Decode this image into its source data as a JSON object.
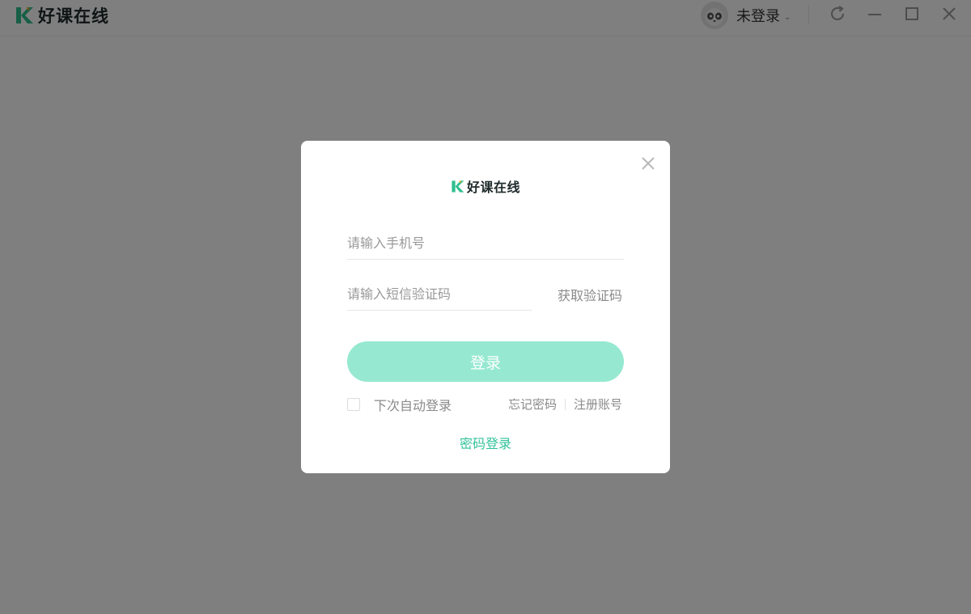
{
  "app": {
    "title": "好课在线",
    "accent_color": "#33c29a",
    "logo_icon": "k-logo-icon"
  },
  "titlebar": {
    "user_name": "未登录",
    "user_caret": "⌄",
    "avatar_icon": "panda-avatar-icon",
    "refresh_icon": "refresh-icon",
    "minimize_icon": "minimize-icon",
    "maximize_icon": "maximize-icon",
    "close_icon": "close-icon"
  },
  "login_dialog": {
    "brand": "好课在线",
    "phone_placeholder": "请输入手机号",
    "phone_value": "",
    "sms_placeholder": "请输入短信验证码",
    "sms_value": "",
    "get_code_label": "获取验证码",
    "login_button_label": "登录",
    "login_button_color": "#96e9d0",
    "auto_login_label": "下次自动登录",
    "auto_login_checked": false,
    "forgot_password_label": "忘记密码",
    "register_label": "注册账号",
    "password_login_label": "密码登录"
  }
}
